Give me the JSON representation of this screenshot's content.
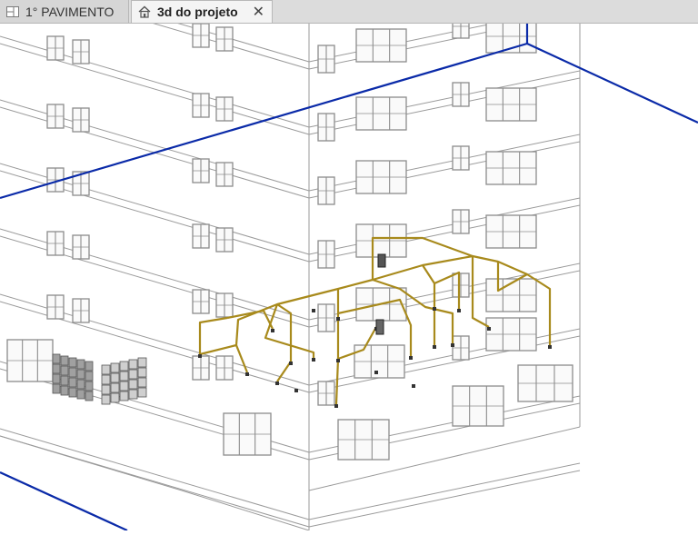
{
  "tabs": [
    {
      "label": "1° PAVIMENTO",
      "icon": "floor-plan-icon",
      "active": false
    },
    {
      "label": "3d do projeto",
      "icon": "house-3d-icon",
      "active": true,
      "close": "✕"
    }
  ],
  "colors": {
    "tabbar_bg": "#dcdcdc",
    "building_lines": "#9a9a9a",
    "section_box": "#0a2aa8",
    "pipes": "#a88a1c",
    "fixtures": "#8c8c8c"
  }
}
